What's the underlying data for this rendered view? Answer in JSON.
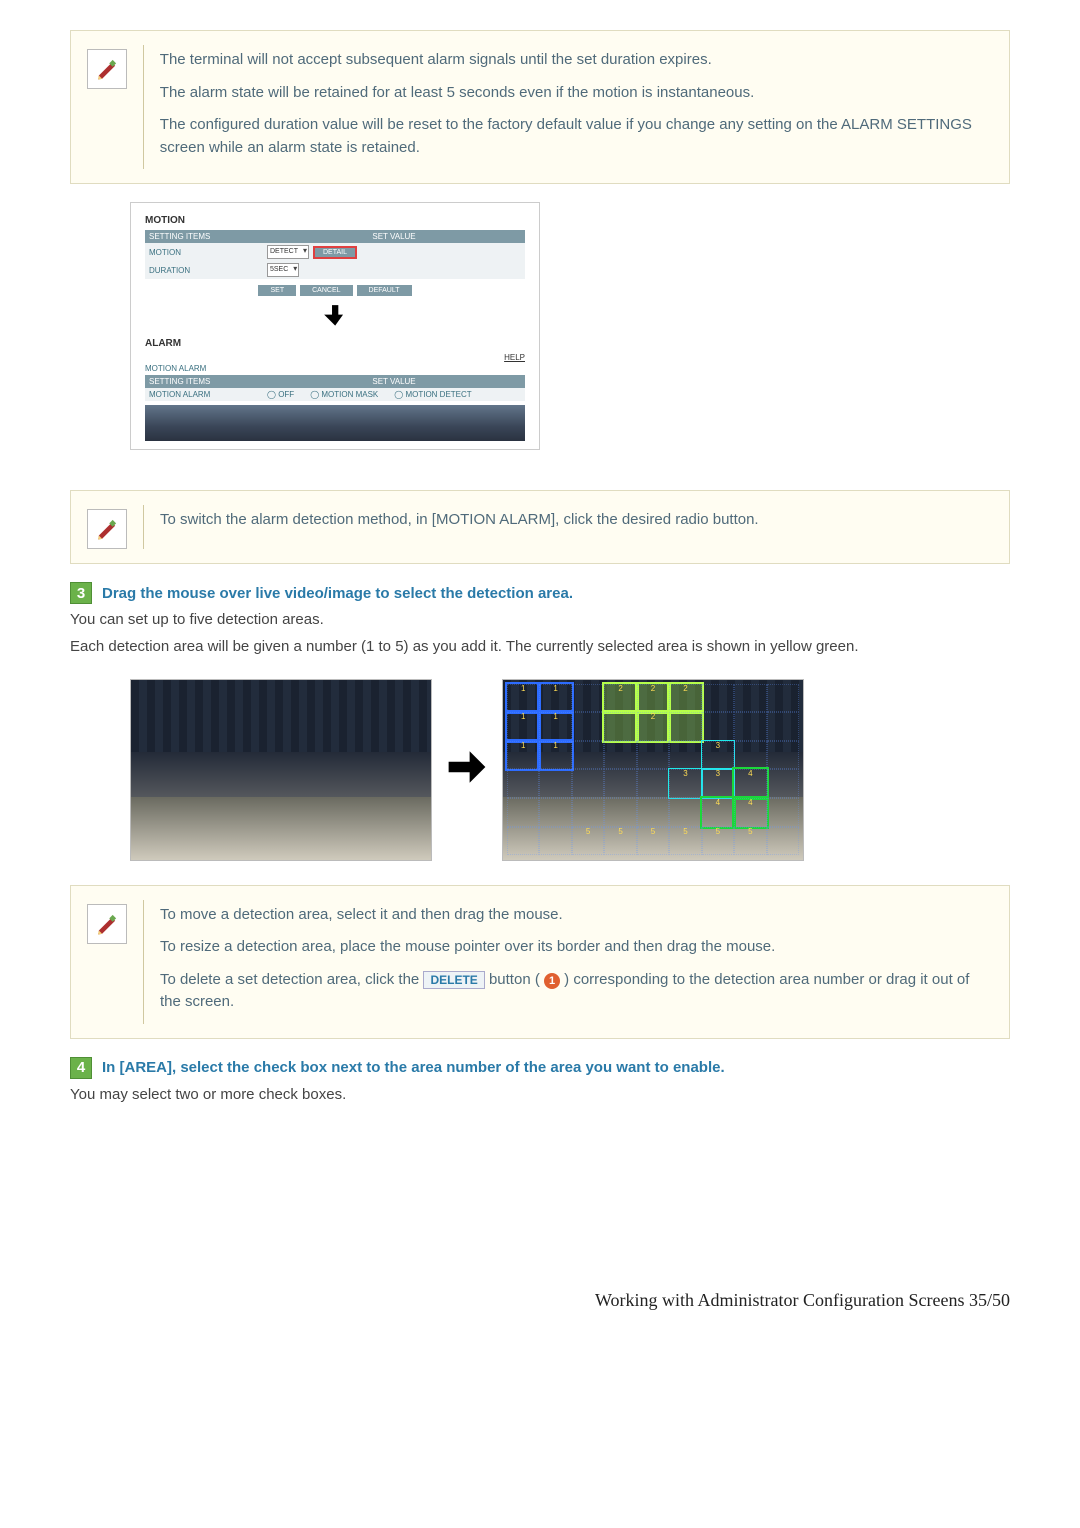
{
  "note1": {
    "p1": "The terminal will not accept subsequent alarm signals until the set duration expires.",
    "p2": "The alarm state will be retained for at least 5 seconds even if the motion is instantaneous.",
    "p3": "The configured duration value will be reset to the factory default value if you change any setting on the ALARM SETTINGS screen while an alarm state is retained."
  },
  "motion_panel": {
    "title": "MOTION",
    "header_left": "SETTING ITEMS",
    "header_right": "SET VALUE",
    "row_motion_label": "MOTION",
    "row_motion_select": "DETECT",
    "row_motion_detail": "DETAIL",
    "row_duration_label": "DURATION",
    "row_duration_select": "5SEC",
    "btn_set": "SET",
    "btn_cancel": "CANCEL",
    "btn_default": "DEFAULT"
  },
  "alarm_panel": {
    "title": "ALARM",
    "help": "HELP",
    "subtitle": "MOTION ALARM",
    "header_left": "SETTING ITEMS",
    "header_right": "SET VALUE",
    "row_label": "MOTION ALARM",
    "opt_off": "OFF",
    "opt_mask": "MOTION MASK",
    "opt_detect": "MOTION DETECT"
  },
  "note2": {
    "p1": "To switch the alarm detection method, in [MOTION ALARM], click the desired radio button."
  },
  "step3": {
    "badge": "3",
    "title": "Drag the mouse over live video/image to select the detection area.",
    "body1": "You can set up to five detection areas.",
    "body2": "Each detection area will be given a number (1 to 5) as you add it. The currently selected area is shown in yellow green."
  },
  "note3": {
    "p1": "To move a detection area, select it and then drag the mouse.",
    "p2": "To resize a detection area, place the mouse pointer over its border and then drag the mouse.",
    "p3a": "To delete a set detection area, click the ",
    "delete_label": "DELETE",
    "p3b": " button ( ",
    "badge_num": "1",
    "p3c": " ) corresponding to the detection area number or drag it out of the screen."
  },
  "step4": {
    "badge": "4",
    "title": "In [AREA], select the check box next to the area number of the area you want to enable.",
    "body1": "You may select two or more check boxes."
  },
  "footer": "Working with Administrator Configuration Screens 35/50"
}
